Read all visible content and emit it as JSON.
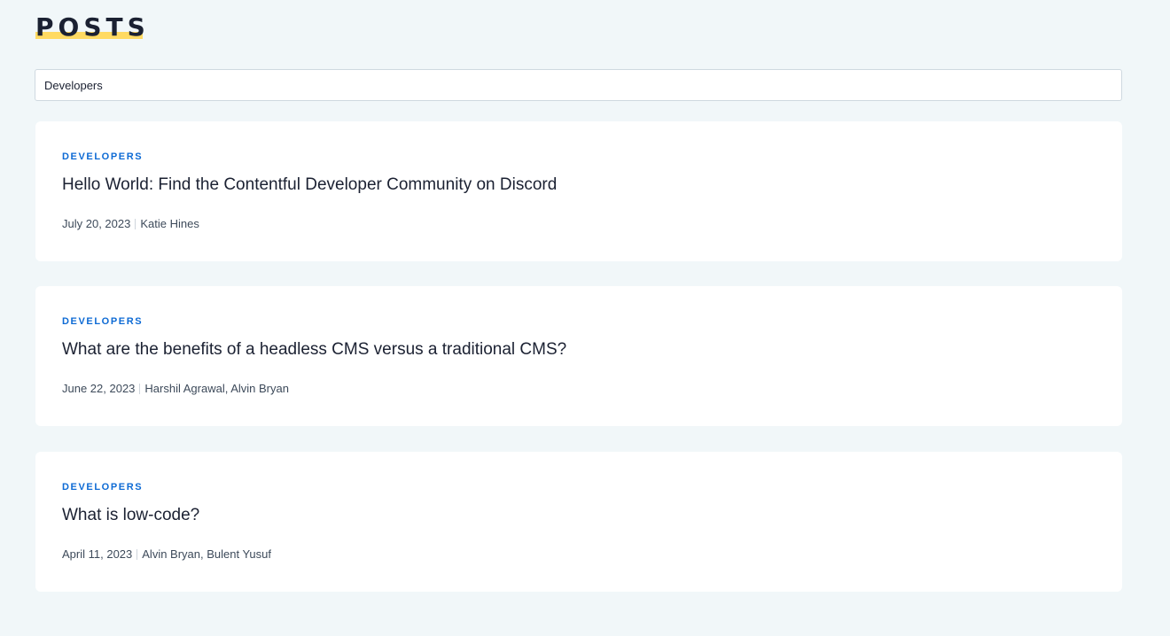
{
  "header": {
    "title": "POSTS",
    "underline_color": "#ffda62"
  },
  "search": {
    "value": "Developers"
  },
  "accent_color": "#0d6ad4",
  "posts": [
    {
      "category": "DEVELOPERS",
      "title": "Hello World: Find the Contentful Developer Community on Discord",
      "date": "July 20, 2023",
      "authors": "Katie Hines"
    },
    {
      "category": "DEVELOPERS",
      "title": "What are the benefits of a headless CMS versus a traditional CMS?",
      "date": "June 22, 2023",
      "authors": "Harshil Agrawal, Alvin Bryan"
    },
    {
      "category": "DEVELOPERS",
      "title": "What is low-code?",
      "date": "April 11, 2023",
      "authors": "Alvin Bryan, Bulent Yusuf"
    }
  ]
}
